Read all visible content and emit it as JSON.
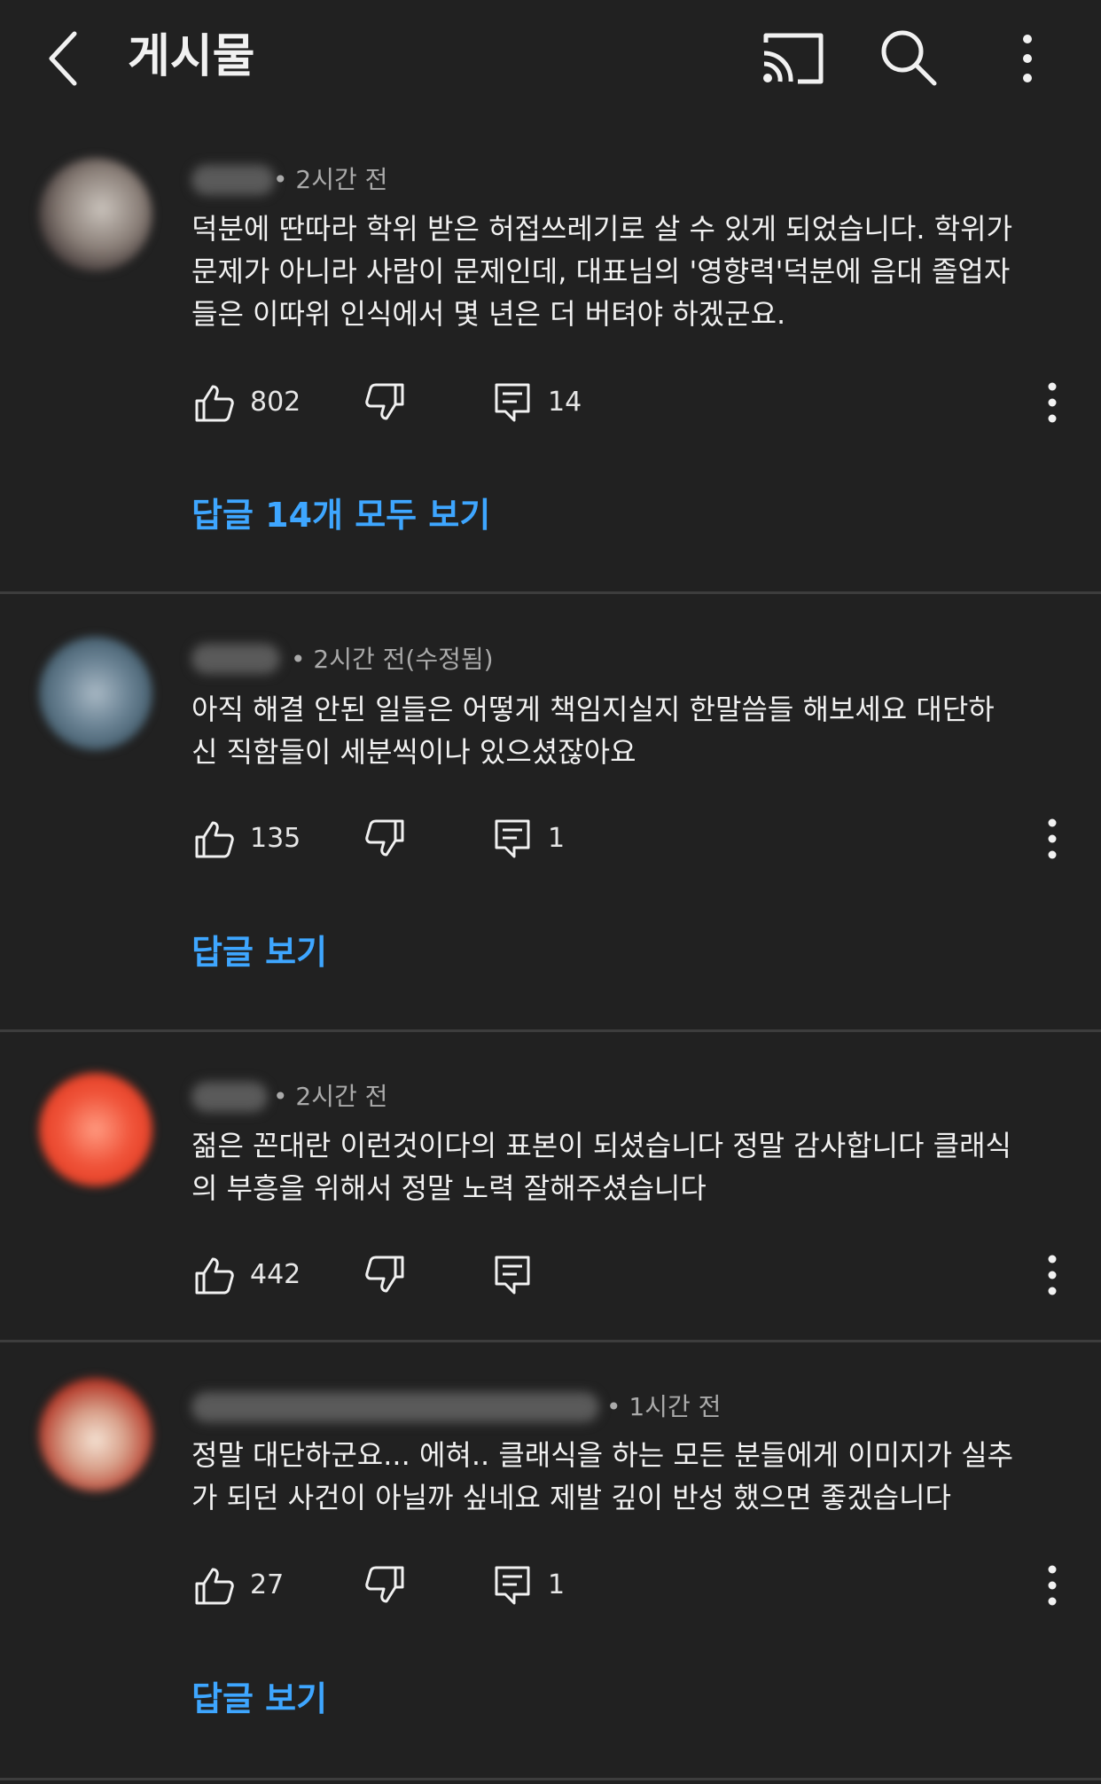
{
  "header": {
    "title": "게시물",
    "icons": [
      "back-arrow-icon",
      "cast-icon",
      "search-icon",
      "more-vert-icon"
    ]
  },
  "comments": [
    {
      "time": "• 2시간 전",
      "text": "덕분에 딴따라 학위 받은 허접쓰레기로 살 수 있게 되었습니다. 학위가\n문제가 아니라 사람이 문제인데, 대표님의 '영향력'덕분에 음대 졸업자\n들은 이따위 인식에서 몇 년은 더 버텨야 하겠군요.",
      "likes": "802",
      "reply_count": "14",
      "replies_link": "답글 14개 모두 보기"
    },
    {
      "time": "• 2시간 전(수정됨)",
      "text": "아직 해결 안된 일들은 어떻게 책임지실지 한말씀들 해보세요 대단하\n신 직함들이 세분씩이나 있으셨잖아요",
      "likes": "135",
      "reply_count": "1",
      "replies_link": "답글 보기"
    },
    {
      "time": "• 2시간 전",
      "text": "젊은 꼰대란 이런것이다의 표본이 되셨습니다 정말 감사합니다 클래식\n의 부흥을 위해서 정말 노력 잘해주셨습니다",
      "likes": "442",
      "reply_count": "",
      "replies_link": ""
    },
    {
      "time": "• 1시간 전",
      "text": "정말 대단하군요... 에혀.. 클래식을 하는 모든 분들에게 이미지가 실추\n가 되던 사건이 아닐까 싶네요 제발 깊이 반성 했으면 좋겠습니다",
      "likes": "27",
      "reply_count": "1",
      "replies_link": "답글 보기"
    }
  ],
  "colors": {
    "background": "#212121",
    "divider": "#3d3d3d",
    "link": "#3ea6ff",
    "text": "#f1f1f1",
    "meta": "#aaaaaa"
  }
}
